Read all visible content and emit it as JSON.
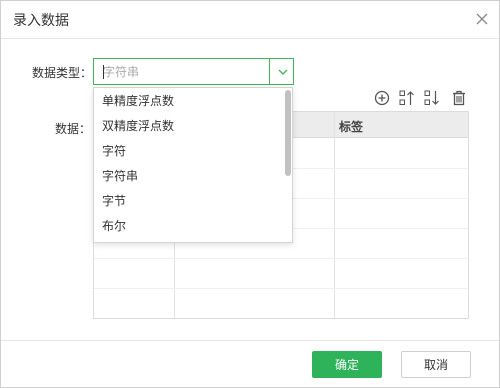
{
  "dialog": {
    "title": "录入数据"
  },
  "form": {
    "type_label": "数据类型：",
    "type_placeholder": "字符串",
    "data_label": "数据："
  },
  "toolbar": {
    "icons": [
      "add-circle-icon",
      "sort-ascending-icon",
      "sort-descending-icon",
      "trash-icon"
    ]
  },
  "table": {
    "columns": [
      "",
      "",
      "标签"
    ]
  },
  "dropdown": {
    "options": [
      "单精度浮点数",
      "双精度浮点数",
      "字符",
      "字符串",
      "字节",
      "布尔"
    ]
  },
  "footer": {
    "ok_label": "确定",
    "cancel_label": "取消"
  },
  "colors": {
    "accent": "#2fb35a",
    "border_focus": "#3fb65a"
  }
}
